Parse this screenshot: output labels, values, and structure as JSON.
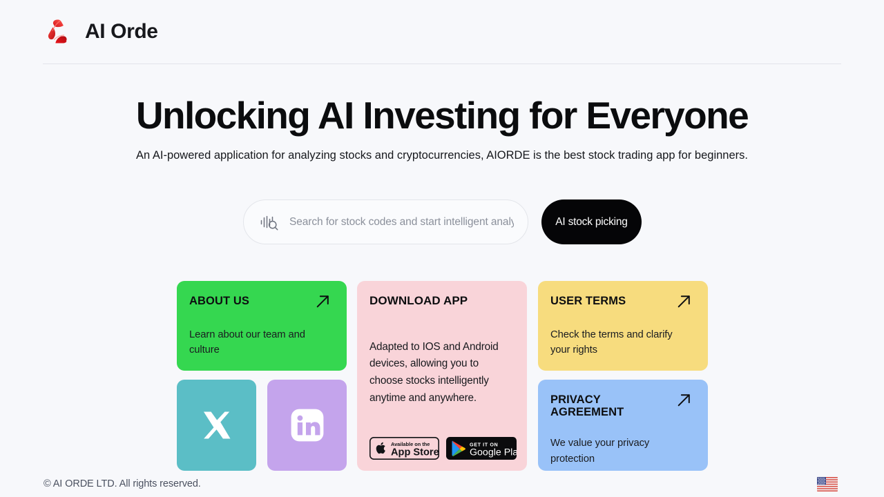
{
  "header": {
    "logo_icon": "aiorde-triangle-logo",
    "brand_name": "AI Orde",
    "logo_colors": {
      "primary": "#e8151b",
      "dark": "#b80d12",
      "light": "#f4453f"
    }
  },
  "hero": {
    "title": "Unlocking AI Investing for Everyone",
    "subtitle": "An AI-powered application for analyzing stocks and cryptocurrencies, AIORDE is the best stock trading app for beginners."
  },
  "search": {
    "icon": "waveform-search-icon",
    "value": "",
    "placeholder": "Search for stock codes and start intelligent analysi",
    "cta_label": "AI stock picking",
    "cta_color": "#050507"
  },
  "cards": {
    "about": {
      "title": "ABOUT US",
      "body": "Learn about our team and culture",
      "color": "#35d750",
      "arrow_icon": "arrow-up-right-icon"
    },
    "download": {
      "title": "DOWNLOAD APP",
      "body": "Adapted to IOS and Android devices, allowing you to choose stocks intelligently anytime and anywhere.",
      "color": "#f9d4d9",
      "badges": [
        {
          "icon": "apple-logo-icon",
          "small_label": "Available on the",
          "large_label": "App Store",
          "style": "outline"
        },
        {
          "icon": "google-play-icon",
          "small_label": "GET IT ON",
          "large_label": "Google Play",
          "style": "solid"
        }
      ]
    },
    "user_terms": {
      "title": "USER TERMS",
      "body": "Check the terms and clarify your rights",
      "color": "#f7dc7e",
      "arrow_icon": "arrow-up-right-icon"
    },
    "privacy": {
      "title": "PRIVACY AGREEMENT",
      "body": "We value your privacy protection",
      "color": "#99c2f8",
      "arrow_icon": "arrow-up-right-icon"
    }
  },
  "social": {
    "x": {
      "icon": "x-twitter-icon",
      "color": "#5bbec6"
    },
    "linkedin": {
      "icon": "linkedin-icon",
      "color": "#c4a4ec"
    }
  },
  "footer": {
    "copyright": "© AI ORDE LTD. All rights reserved.",
    "locale_icon": "us-flag-icon"
  }
}
